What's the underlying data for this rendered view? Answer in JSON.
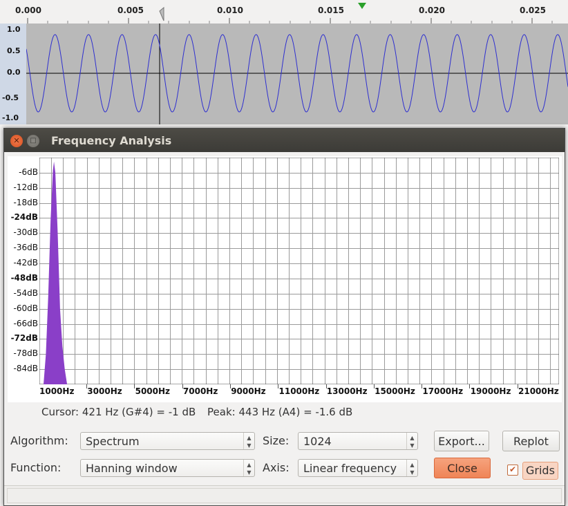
{
  "ruler": {
    "ticks": [
      "0.000",
      "0.005",
      "0.010",
      "0.015",
      "0.020",
      "0.025"
    ]
  },
  "track": {
    "amplitude_labels": [
      "1.0",
      "0.5",
      "0.0",
      "-0.5",
      "-1.0"
    ],
    "waveform_color": "#2d2ed0"
  },
  "dialog": {
    "title": "Frequency Analysis",
    "db_labels": [
      {
        "text": "-6dB",
        "bold": false
      },
      {
        "text": "-12dB",
        "bold": false
      },
      {
        "text": "-18dB",
        "bold": false
      },
      {
        "text": "-24dB",
        "bold": true
      },
      {
        "text": "-30dB",
        "bold": false
      },
      {
        "text": "-36dB",
        "bold": false
      },
      {
        "text": "-42dB",
        "bold": false
      },
      {
        "text": "-48dB",
        "bold": true
      },
      {
        "text": "-54dB",
        "bold": false
      },
      {
        "text": "-60dB",
        "bold": false
      },
      {
        "text": "-66dB",
        "bold": false
      },
      {
        "text": "-72dB",
        "bold": true
      },
      {
        "text": "-78dB",
        "bold": false
      },
      {
        "text": "-84dB",
        "bold": false
      }
    ],
    "hz_labels": [
      "1000Hz",
      "3000Hz",
      "5000Hz",
      "7000Hz",
      "9000Hz",
      "11000Hz",
      "13000Hz",
      "15000Hz",
      "17000Hz",
      "19000Hz",
      "21000Hz"
    ],
    "spectrum_color": "#8a3fc8",
    "cursor_text": "Cursor: 421 Hz (G#4) = -1 dB",
    "peak_text": "Peak: 443 Hz (A4) = -1.6 dB",
    "algorithm_label": "Algorithm:",
    "algorithm_value": "Spectrum",
    "function_label": "Function:",
    "function_value": "Hanning window",
    "size_label": "Size:",
    "size_value": "1024",
    "axis_label": "Axis:",
    "axis_value": "Linear frequency",
    "export_label": "Export...",
    "replot_label": "Replot",
    "close_label": "Close",
    "grids_label": "Grids",
    "grids_checked": true
  },
  "chart_data": {
    "type": "area",
    "x_axis": "frequency (Hz), linear",
    "y_axis": "dB",
    "ylim": [
      -90,
      0
    ],
    "peak": {
      "x": 443,
      "y": -1.6
    },
    "x": [
      0,
      100,
      200,
      300,
      400,
      443,
      500,
      600,
      700,
      800,
      900,
      1000
    ],
    "y": [
      -90,
      -78,
      -55,
      -25,
      -5,
      -1.6,
      -6,
      -30,
      -60,
      -75,
      -84,
      -90
    ]
  }
}
